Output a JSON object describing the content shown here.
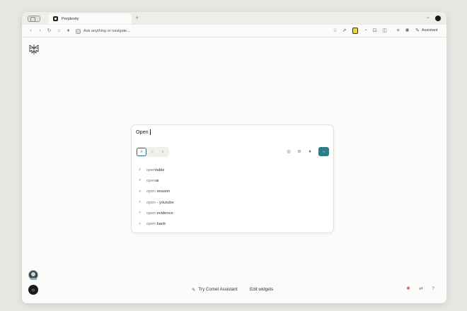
{
  "tabbar": {
    "tab_title": "Perplexity",
    "new_tab_glyph": "+",
    "menu_chevron_glyph": "⌄"
  },
  "toolbar": {
    "back_glyph": "‹",
    "forward_glyph": "›",
    "reload_glyph": "↻",
    "home_glyph": "⌂",
    "mic_glyph": "♦",
    "omnibox_text": "Ask anything or navigate...",
    "star_glyph": "☆",
    "share_glyph": "⇗",
    "ext2_glyph": "◔",
    "ext3_glyph": "⊡",
    "ext4_glyph": "◫",
    "menu_glyph": "≡",
    "settings_glyph": "✺",
    "assistant_glyph": "✎",
    "assistant_label": "Assistant"
  },
  "search": {
    "query": "Open",
    "modes": [
      {
        "icon": "search-icon",
        "glyph": "⌕"
      },
      {
        "icon": "grid-icon",
        "glyph": "⁘"
      },
      {
        "icon": "bulb-icon",
        "glyph": "♁"
      }
    ],
    "globe_glyph": "◎",
    "attach_glyph": "⊘",
    "mic_glyph": "♦",
    "submit_glyph": "→",
    "accent_color": "#2d7c87",
    "suggestions": [
      {
        "prefix": "open",
        "rest": "table"
      },
      {
        "prefix": "open",
        "rest": "ai"
      },
      {
        "prefix": "open",
        "rest": " season"
      },
      {
        "prefix": "open",
        "rest": " - youtube"
      },
      {
        "prefix": "open",
        "rest": " evidence"
      },
      {
        "prefix": "open",
        "rest": " bank"
      }
    ],
    "suggestion_glyph": "⌕"
  },
  "bottom": {
    "comet_glyph": "✎",
    "comet_label": "Try Comet Assistant",
    "edit_label": "Edit widgets",
    "theme_glyph": "☼",
    "corner_red_glyph": "✺",
    "corner_translate_glyph": "⇄",
    "corner_help_glyph": "?"
  }
}
